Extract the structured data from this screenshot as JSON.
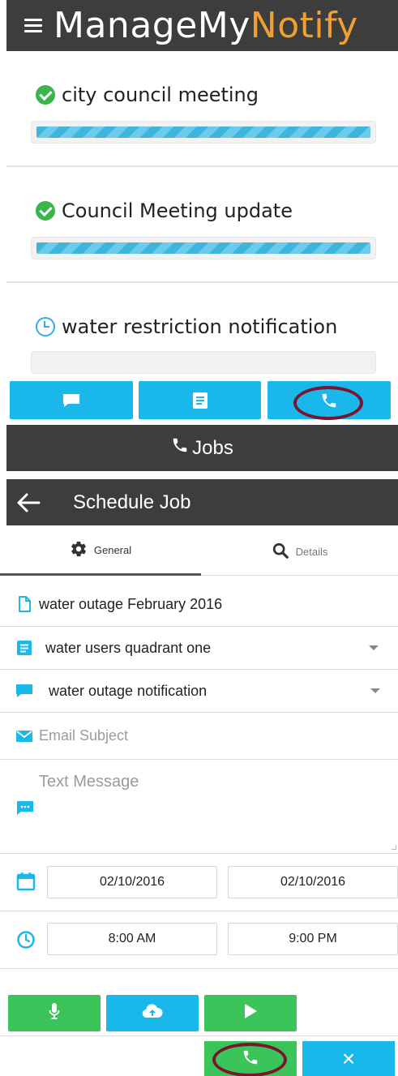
{
  "app": {
    "title_main": "ManageMy",
    "title_accent": "Notify",
    "accent_color": "#f0a030",
    "header_bg": "#3d3d3d"
  },
  "notifications": [
    {
      "title": "city council meeting",
      "status": "complete",
      "progress": 1.0
    },
    {
      "title": "Council Meeting update",
      "status": "complete",
      "progress": 1.0
    },
    {
      "title": "water restriction notification",
      "status": "pending",
      "progress": 0.0
    }
  ],
  "tabbar": {
    "items": [
      {
        "icon": "chat-icon"
      },
      {
        "icon": "list-icon"
      },
      {
        "icon": "phone-icon",
        "selected": true
      }
    ],
    "color": "#1ab7ea"
  },
  "jobs": {
    "title": "Jobs"
  },
  "schedule": {
    "title": "Schedule Job",
    "tabs": [
      {
        "label": "General",
        "icon": "gear-icon",
        "active": true
      },
      {
        "label": "Details",
        "icon": "search-icon",
        "active": false
      }
    ],
    "job_name": "water outage February 2016",
    "recipient_list": "water users quadrant one",
    "message_template": "water outage notification",
    "email_subject_placeholder": "Email Subject",
    "text_message_placeholder": "Text Message",
    "start_date": "02/10/2016",
    "end_date": "02/10/2016",
    "start_time": "8:00 AM",
    "end_time": "9:00 PM",
    "media_buttons": [
      {
        "icon": "microphone-icon",
        "color": "#3bc45a"
      },
      {
        "icon": "cloud-upload-icon",
        "color": "#1ab7ea"
      },
      {
        "icon": "play-icon",
        "color": "#3bc45a"
      }
    ],
    "actions": [
      {
        "icon": "phone-icon",
        "color": "#3bc45a"
      },
      {
        "icon": "close-icon",
        "color": "#1ab7ea",
        "glyph": "×"
      }
    ]
  }
}
